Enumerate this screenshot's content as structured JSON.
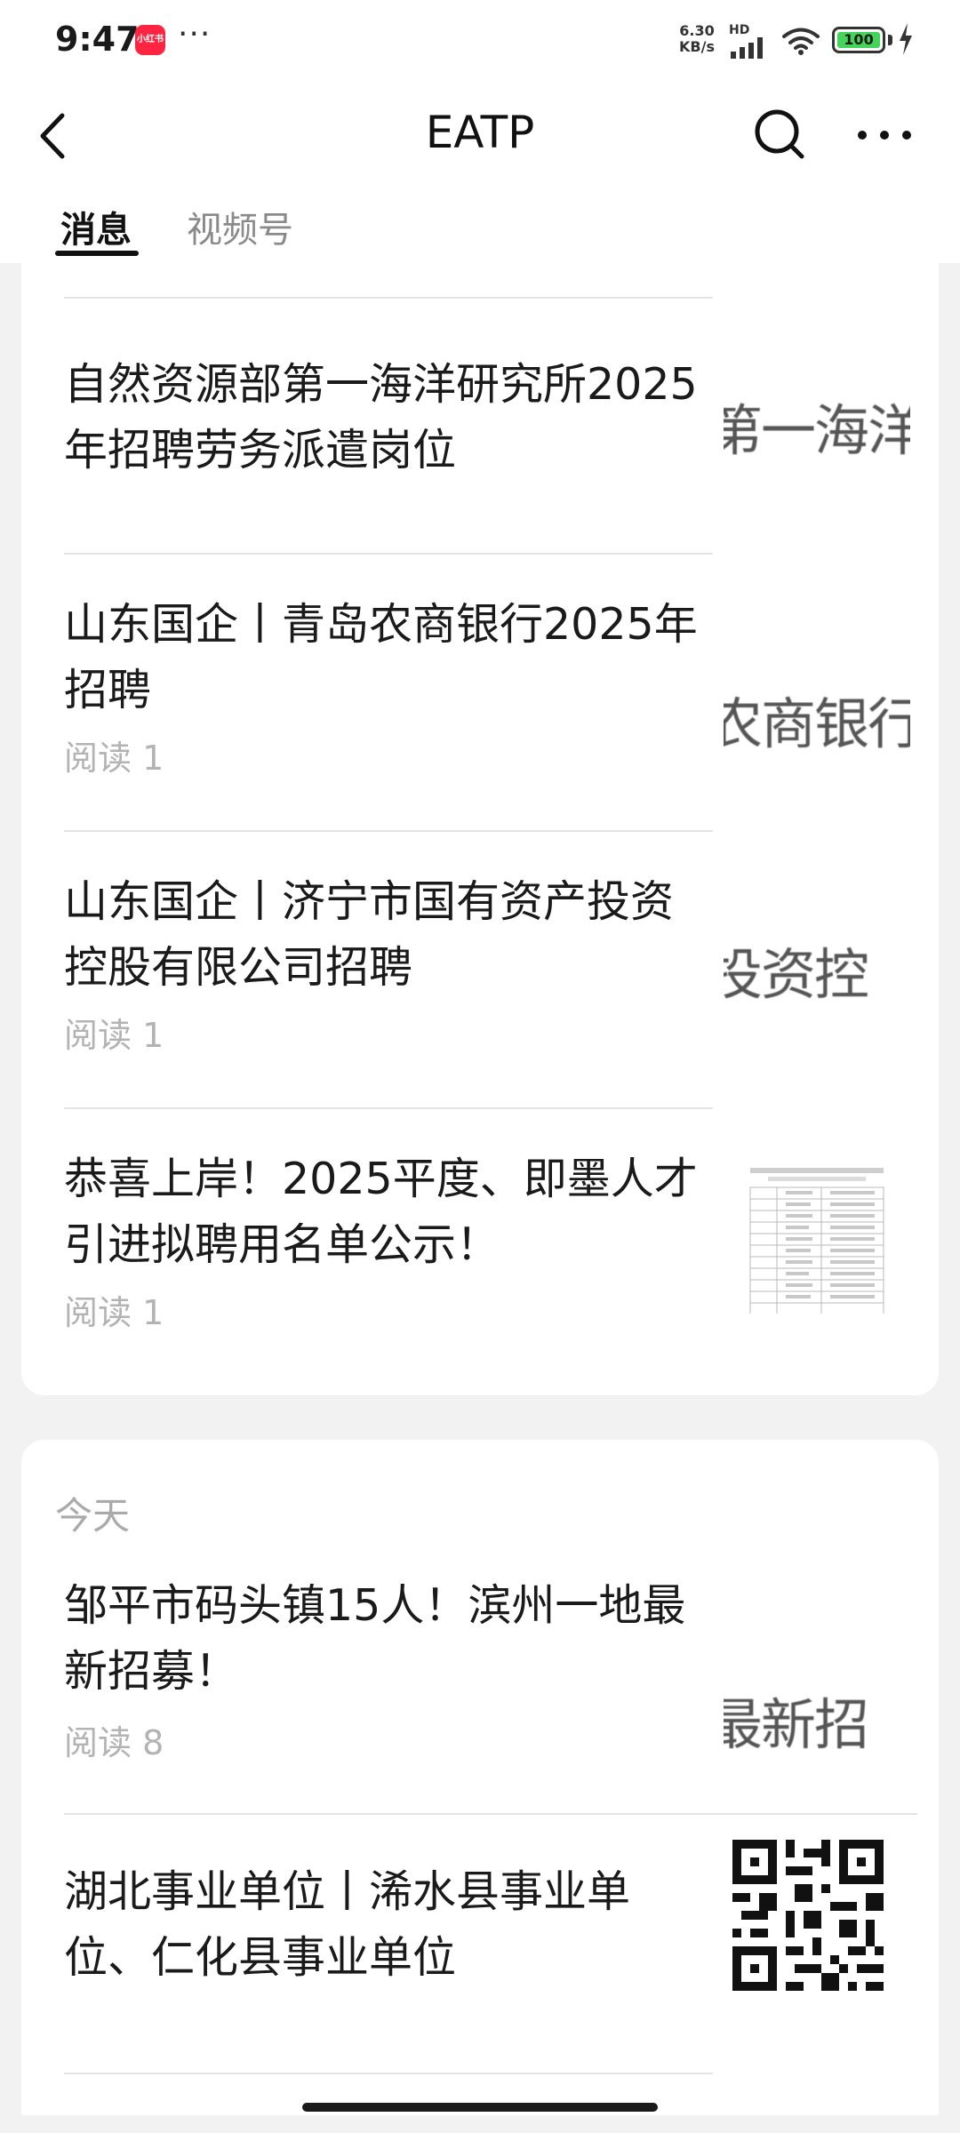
{
  "status_bar": {
    "time": "9:47",
    "app_icon_label": "小红书",
    "overflow_dots": "···",
    "net_speed_top": "6.30",
    "net_speed_bottom": "KB/s",
    "hd_label": "HD",
    "battery_level": "100",
    "icons": [
      "signal-icon",
      "wifi-icon",
      "battery-icon",
      "charging-icon"
    ]
  },
  "nav": {
    "title": "EATP",
    "icons": [
      "back-chevron-icon",
      "search-icon",
      "more-icon"
    ]
  },
  "tabs": [
    {
      "label": "消息",
      "active": true
    },
    {
      "label": "视频号",
      "active": false
    }
  ],
  "articles_earlier": [
    {
      "title": "自然资源部第一海洋研究所2025年招聘劳务派遣岗位",
      "read": "",
      "thumb_text": "第一海洋研"
    },
    {
      "title": "山东国企丨青岛农商银行2025年招聘",
      "read": "阅读 1",
      "thumb_text": "农商银行"
    },
    {
      "title": "山东国企丨济宁市国有资产投资控股有限公司招聘",
      "read": "阅读 1",
      "thumb_text": "投资控"
    },
    {
      "title": "恭喜上岸！2025平度、即墨人才引进拟聘用名单公示！",
      "read": "阅读 1",
      "thumb_text": ""
    }
  ],
  "today_section": {
    "label": "今天",
    "articles": [
      {
        "title": "邹平市码头镇15人！滨州一地最新招募！",
        "read": "阅读 8",
        "thumb_text": "最新招"
      },
      {
        "title": "湖北事业单位丨浠水县事业单位、仁化县事业单位",
        "read": "",
        "thumb_text": ""
      }
    ]
  },
  "colors": {
    "background": "#f2f2f2",
    "card": "#ffffff",
    "read_count": "#b3b3b3",
    "battery_fill": "#45d45a",
    "app_icon": "#ff2442"
  }
}
